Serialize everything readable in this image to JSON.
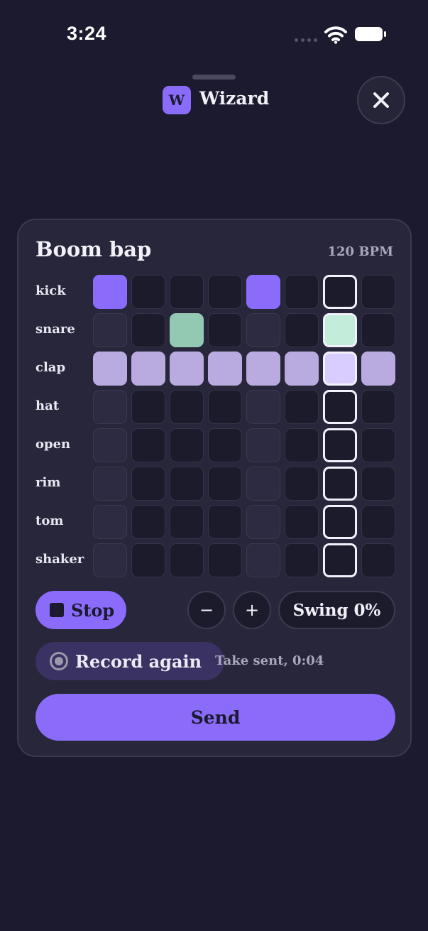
{
  "status_bar": {
    "time": "3:24",
    "icons": [
      "signal-dots-icon",
      "wifi-icon",
      "battery-icon"
    ]
  },
  "header": {
    "logo_letter": "W",
    "app_name": "Wizard",
    "close_icon": "close-icon"
  },
  "pattern": {
    "title": "Boom bap",
    "bpm_label": "120 BPM",
    "playhead_step": 7,
    "rows": [
      {
        "label": "kick",
        "steps": [
          1,
          0,
          0,
          0,
          1,
          0,
          0,
          0
        ]
      },
      {
        "label": "snare",
        "steps": [
          0,
          0,
          1,
          0,
          0,
          0,
          1,
          0
        ]
      },
      {
        "label": "clap",
        "steps": [
          1,
          1,
          1,
          1,
          1,
          1,
          1,
          1
        ]
      },
      {
        "label": "hat",
        "steps": [
          0,
          0,
          0,
          0,
          0,
          0,
          0,
          0
        ]
      },
      {
        "label": "open",
        "steps": [
          0,
          0,
          0,
          0,
          0,
          0,
          0,
          0
        ]
      },
      {
        "label": "rim",
        "steps": [
          0,
          0,
          0,
          0,
          0,
          0,
          0,
          0
        ]
      },
      {
        "label": "tom",
        "steps": [
          0,
          0,
          0,
          0,
          0,
          0,
          0,
          0
        ]
      },
      {
        "label": "shaker",
        "steps": [
          0,
          0,
          0,
          0,
          0,
          0,
          0,
          0
        ]
      }
    ]
  },
  "controls": {
    "stop_label": "Stop",
    "minus_label": "−",
    "plus_label": "+",
    "swing_label": "Swing 0%",
    "record_label": "Record again",
    "take_status": "Take sent, 0:04",
    "send_label": "Send"
  },
  "colors": {
    "background": "#1b1a2e",
    "accent": "#8b6cfa",
    "snare_on": "#93c8b2",
    "clap_on": "#b9abe0"
  }
}
